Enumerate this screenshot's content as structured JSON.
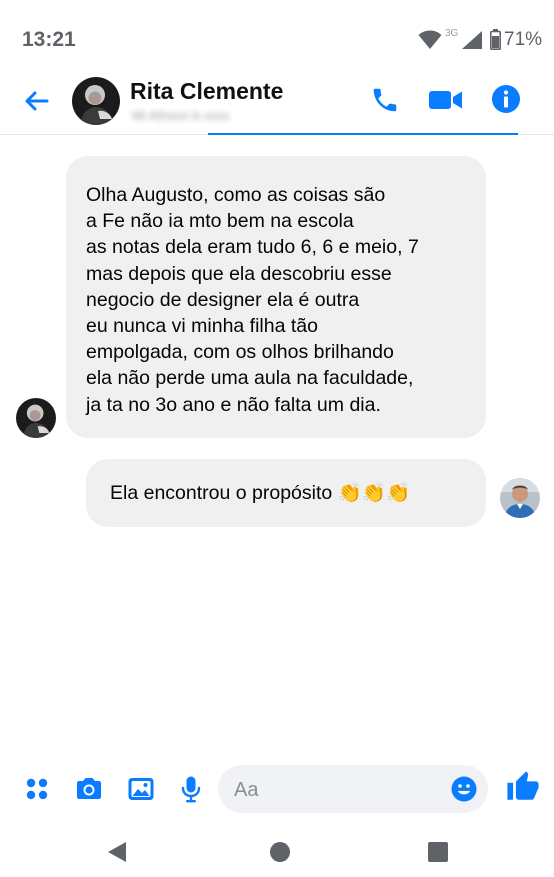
{
  "status_bar": {
    "time": "13:21",
    "network": "3G",
    "battery": "71%",
    "icons": [
      "wifi-icon",
      "signal-icon",
      "battery-icon"
    ]
  },
  "header": {
    "contact_name": "Rita Clemente",
    "contact_status": "Mi Athson b xxxx",
    "icons": [
      "back-arrow-icon",
      "phone-icon",
      "video-icon",
      "info-icon"
    ]
  },
  "messages": [
    {
      "direction": "incoming",
      "lines": [
        "Olha Augusto, como as coisas são",
        "a Fe não ia mto bem na escola",
        "as notas dela eram tudo 6, 6 e meio, 7",
        "mas depois que ela descobriu esse",
        "negocio de designer ela é outra",
        "eu nunca vi minha filha tão",
        "empolgada, com os olhos brilhando",
        "ela não perde uma aula na faculdade,",
        "ja ta no 3o ano e não falta um dia."
      ]
    },
    {
      "direction": "outgoing",
      "text": "Ela encontrou o propósito 👏👏👏"
    }
  ],
  "composer": {
    "placeholder": "Aa",
    "value": "",
    "icons": [
      "menu-dots-icon",
      "camera-icon",
      "gallery-icon",
      "microphone-icon",
      "emoji-icon",
      "thumbs-up-icon"
    ]
  },
  "nav_bar": {
    "icons": [
      "back-triangle-icon",
      "home-circle-icon",
      "recents-square-icon"
    ]
  },
  "colors": {
    "accent": "#0a7cff",
    "bubble": "#f0f0f0",
    "input_bg": "#f0f2f5",
    "nav_icon": "#5f6368"
  }
}
